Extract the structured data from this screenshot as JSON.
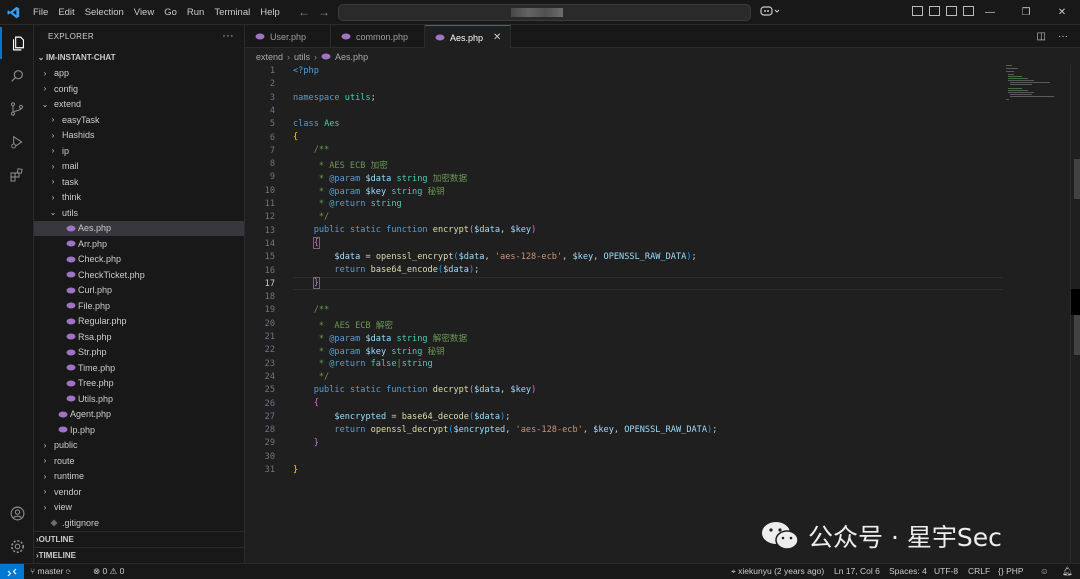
{
  "titlebar": {
    "menu": [
      "File",
      "Edit",
      "Selection",
      "View",
      "Go",
      "Run",
      "Terminal",
      "Help"
    ],
    "back": "←",
    "forward": "→"
  },
  "sidebar": {
    "title": "EXPLORER",
    "more": "···",
    "root": "IM-INSTANT-CHAT",
    "items": [
      {
        "label": "app",
        "depth": 1,
        "kind": "folder",
        "open": false
      },
      {
        "label": "config",
        "depth": 1,
        "kind": "folder",
        "open": false
      },
      {
        "label": "extend",
        "depth": 1,
        "kind": "folder",
        "open": true
      },
      {
        "label": "easyTask",
        "depth": 2,
        "kind": "folder",
        "open": false
      },
      {
        "label": "Hashids",
        "depth": 2,
        "kind": "folder",
        "open": false
      },
      {
        "label": "ip",
        "depth": 2,
        "kind": "folder",
        "open": false
      },
      {
        "label": "mail",
        "depth": 2,
        "kind": "folder",
        "open": false
      },
      {
        "label": "task",
        "depth": 2,
        "kind": "folder",
        "open": false
      },
      {
        "label": "think",
        "depth": 2,
        "kind": "folder",
        "open": false
      },
      {
        "label": "utils",
        "depth": 2,
        "kind": "folder",
        "open": true
      },
      {
        "label": "Aes.php",
        "depth": 3,
        "kind": "php",
        "selected": true
      },
      {
        "label": "Arr.php",
        "depth": 3,
        "kind": "php"
      },
      {
        "label": "Check.php",
        "depth": 3,
        "kind": "php"
      },
      {
        "label": "CheckTicket.php",
        "depth": 3,
        "kind": "php"
      },
      {
        "label": "Curl.php",
        "depth": 3,
        "kind": "php"
      },
      {
        "label": "File.php",
        "depth": 3,
        "kind": "php"
      },
      {
        "label": "Regular.php",
        "depth": 3,
        "kind": "php"
      },
      {
        "label": "Rsa.php",
        "depth": 3,
        "kind": "php"
      },
      {
        "label": "Str.php",
        "depth": 3,
        "kind": "php"
      },
      {
        "label": "Time.php",
        "depth": 3,
        "kind": "php"
      },
      {
        "label": "Tree.php",
        "depth": 3,
        "kind": "php"
      },
      {
        "label": "Utils.php",
        "depth": 3,
        "kind": "php"
      },
      {
        "label": "Agent.php",
        "depth": 2,
        "kind": "php"
      },
      {
        "label": "Ip.php",
        "depth": 2,
        "kind": "php"
      },
      {
        "label": "public",
        "depth": 1,
        "kind": "folder",
        "open": false
      },
      {
        "label": "route",
        "depth": 1,
        "kind": "folder",
        "open": false
      },
      {
        "label": "runtime",
        "depth": 1,
        "kind": "folder",
        "open": false
      },
      {
        "label": "vendor",
        "depth": 1,
        "kind": "folder",
        "open": false
      },
      {
        "label": "view",
        "depth": 1,
        "kind": "folder",
        "open": false
      },
      {
        "label": ".gitignore",
        "depth": 1,
        "kind": "gitignore"
      }
    ],
    "outline": "OUTLINE",
    "timeline": "TIMELINE"
  },
  "tabs": [
    {
      "label": "User.php",
      "active": false
    },
    {
      "label": "common.php",
      "active": false
    },
    {
      "label": "Aes.php",
      "active": true
    }
  ],
  "breadcrumb": [
    "extend",
    "utils",
    "Aes.php"
  ],
  "editor": {
    "current_line": 17,
    "lines": [
      "1",
      "2",
      "3",
      "4",
      "5",
      "6",
      "7",
      "8",
      "9",
      "10",
      "11",
      "12",
      "13",
      "14",
      "15",
      "16",
      "17",
      "18",
      "19",
      "20",
      "21",
      "22",
      "23",
      "24",
      "25",
      "26",
      "27",
      "28",
      "29",
      "30",
      "31"
    ]
  },
  "watermark": {
    "text": "公众号 · 星宇Sec"
  },
  "statusbar": {
    "branch": "master",
    "errors": "0",
    "warnings": "0",
    "blame": "xiekunyu (2 years ago)",
    "position": "Ln 17, Col 6",
    "spaces": "Spaces: 4",
    "encoding": "UTF-8",
    "eol": "CRLF",
    "language": "PHP"
  },
  "colors": {
    "accent": "#0078d4",
    "php_icon": "#a074c4"
  }
}
